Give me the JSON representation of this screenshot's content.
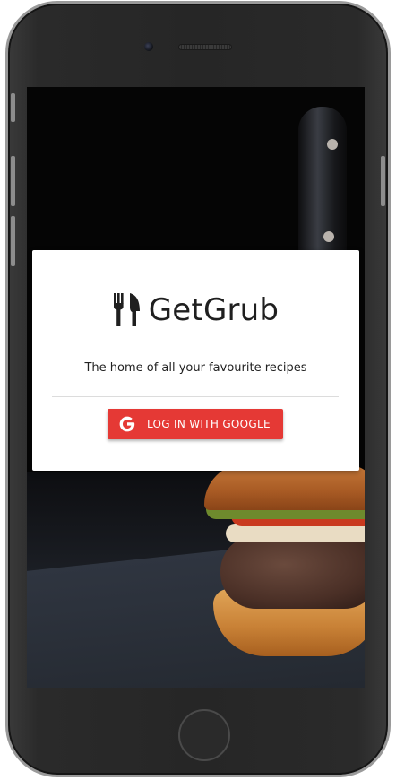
{
  "app": {
    "title": "GetGrub",
    "tagline": "The home of all your favourite recipes"
  },
  "login": {
    "google_button_label": "LOG IN WITH GOOGLE"
  },
  "icons": {
    "brand": "fork-knife-icon",
    "button": "google-icon"
  },
  "colors": {
    "accent": "#e53935",
    "card": "#ffffff",
    "text": "#1f1f1f"
  }
}
